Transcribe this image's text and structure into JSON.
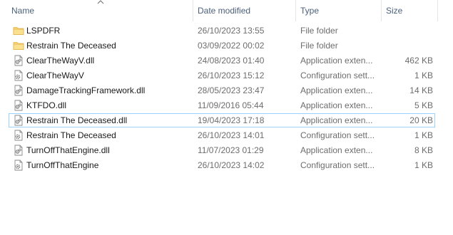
{
  "columns": {
    "name": "Name",
    "date": "Date modified",
    "type": "Type",
    "size": "Size"
  },
  "sort": {
    "column": "name",
    "direction": "ascending",
    "icon": "sort-up-chevron-icon"
  },
  "focused_row": 6,
  "files": [
    {
      "icon": "folder-icon",
      "name": "LSPDFR",
      "date": "26/10/2023 13:55",
      "type": "File folder",
      "size": ""
    },
    {
      "icon": "folder-icon",
      "name": "Restrain The Deceased",
      "date": "03/09/2022 00:02",
      "type": "File folder",
      "size": ""
    },
    {
      "icon": "dll-file-icon",
      "name": "ClearTheWayV.dll",
      "date": "24/08/2023 01:40",
      "type": "Application exten...",
      "size": "462 KB"
    },
    {
      "icon": "config-file-icon",
      "name": "ClearTheWayV",
      "date": "26/10/2023 15:12",
      "type": "Configuration sett...",
      "size": "1 KB"
    },
    {
      "icon": "dll-file-icon",
      "name": "DamageTrackingFramework.dll",
      "date": "28/05/2023 23:47",
      "type": "Application exten...",
      "size": "14 KB"
    },
    {
      "icon": "dll-file-icon",
      "name": "KTFDO.dll",
      "date": "11/09/2016 05:44",
      "type": "Application exten...",
      "size": "5 KB"
    },
    {
      "icon": "dll-file-icon",
      "name": "Restrain The Deceased.dll",
      "date": "19/04/2023 17:18",
      "type": "Application exten...",
      "size": "20 KB"
    },
    {
      "icon": "config-file-icon",
      "name": "Restrain The Deceased",
      "date": "26/10/2023 14:01",
      "type": "Configuration sett...",
      "size": "1 KB"
    },
    {
      "icon": "dll-file-icon",
      "name": "TurnOffThatEngine.dll",
      "date": "11/07/2023 01:29",
      "type": "Application exten...",
      "size": "8 KB"
    },
    {
      "icon": "config-file-icon",
      "name": "TurnOffThatEngine",
      "date": "26/10/2023 14:02",
      "type": "Configuration sett...",
      "size": "1 KB"
    }
  ],
  "colors": {
    "header_text": "#4c607a",
    "name_text": "#1a1a1a",
    "meta_text": "#6d6d6d",
    "folder": "#f8d775",
    "focus_border": "#99d1ff"
  }
}
